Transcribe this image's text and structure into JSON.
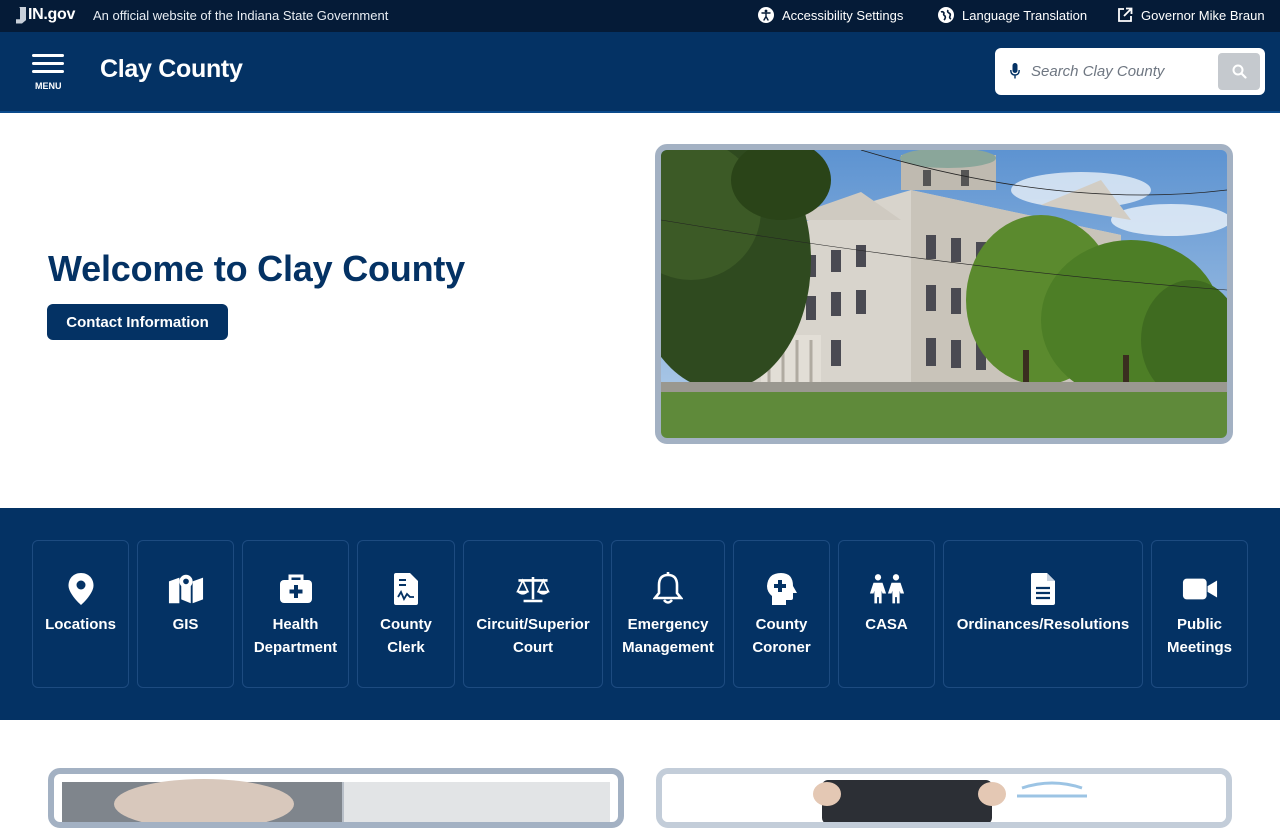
{
  "topbar": {
    "brand": "IN.gov",
    "official_text": "An official website of the Indiana State Government",
    "links": [
      {
        "label": "Accessibility Settings",
        "icon": "accessibility-icon"
      },
      {
        "label": "Language Translation",
        "icon": "globe-icon"
      },
      {
        "label": "Governor Mike Braun",
        "icon": "external-link-icon"
      }
    ]
  },
  "header": {
    "menu_label": "MENU",
    "title": "Clay County",
    "search": {
      "placeholder": "Search Clay County",
      "value": ""
    }
  },
  "hero": {
    "heading": "Welcome to Clay County",
    "button": "Contact Information"
  },
  "quick_links": [
    {
      "label": "Locations",
      "icon": "map-pin-icon"
    },
    {
      "label": "GIS",
      "icon": "map-icon"
    },
    {
      "label": "Health Department",
      "icon": "medical-kit-icon"
    },
    {
      "label": "County Clerk",
      "icon": "signed-document-icon"
    },
    {
      "label": "Circuit/Superior Court",
      "icon": "scales-icon"
    },
    {
      "label": "Emergency Management",
      "icon": "bell-icon"
    },
    {
      "label": "County Coroner",
      "icon": "head-plus-icon"
    },
    {
      "label": "CASA",
      "icon": "children-icon"
    },
    {
      "label": "Ordinances/Resolutions",
      "icon": "document-icon"
    },
    {
      "label": "Public Meetings",
      "icon": "video-camera-icon"
    }
  ],
  "colors": {
    "navy": "#043264",
    "topbar": "#051b37",
    "frame": "#a3b1c3"
  }
}
